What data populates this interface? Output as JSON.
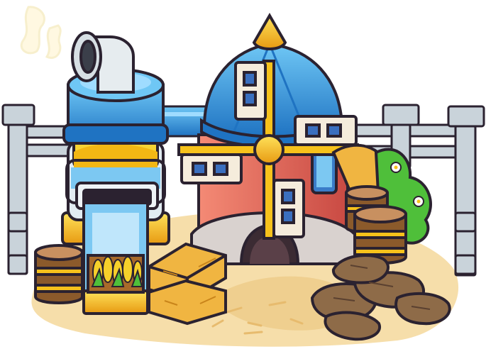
{
  "scene": {
    "subject": "farm-mill-building",
    "elements": [
      "smoke-puff",
      "fence",
      "silo",
      "pipe",
      "windmill",
      "windmill-blades",
      "corn-crate",
      "hay-bales",
      "barrel",
      "bush",
      "grain-sacks",
      "ground-dirt"
    ]
  },
  "colors": {
    "outline": "#2b2230",
    "roof_blue": "#3aa6e8",
    "roof_blue_dark": "#1f73c2",
    "gold": "#f7c21b",
    "gold_dark": "#d98b0c",
    "tower_red": "#e86a5a",
    "tower_stone": "#d9d2cf",
    "fence_grey": "#c9d3da",
    "wood": "#8b5a2b",
    "hay": "#f0b541",
    "sack": "#8e6b48",
    "bush_green": "#4fbf3a",
    "glass_blue": "#7cc8f2",
    "dirt": "#f3d49b"
  }
}
